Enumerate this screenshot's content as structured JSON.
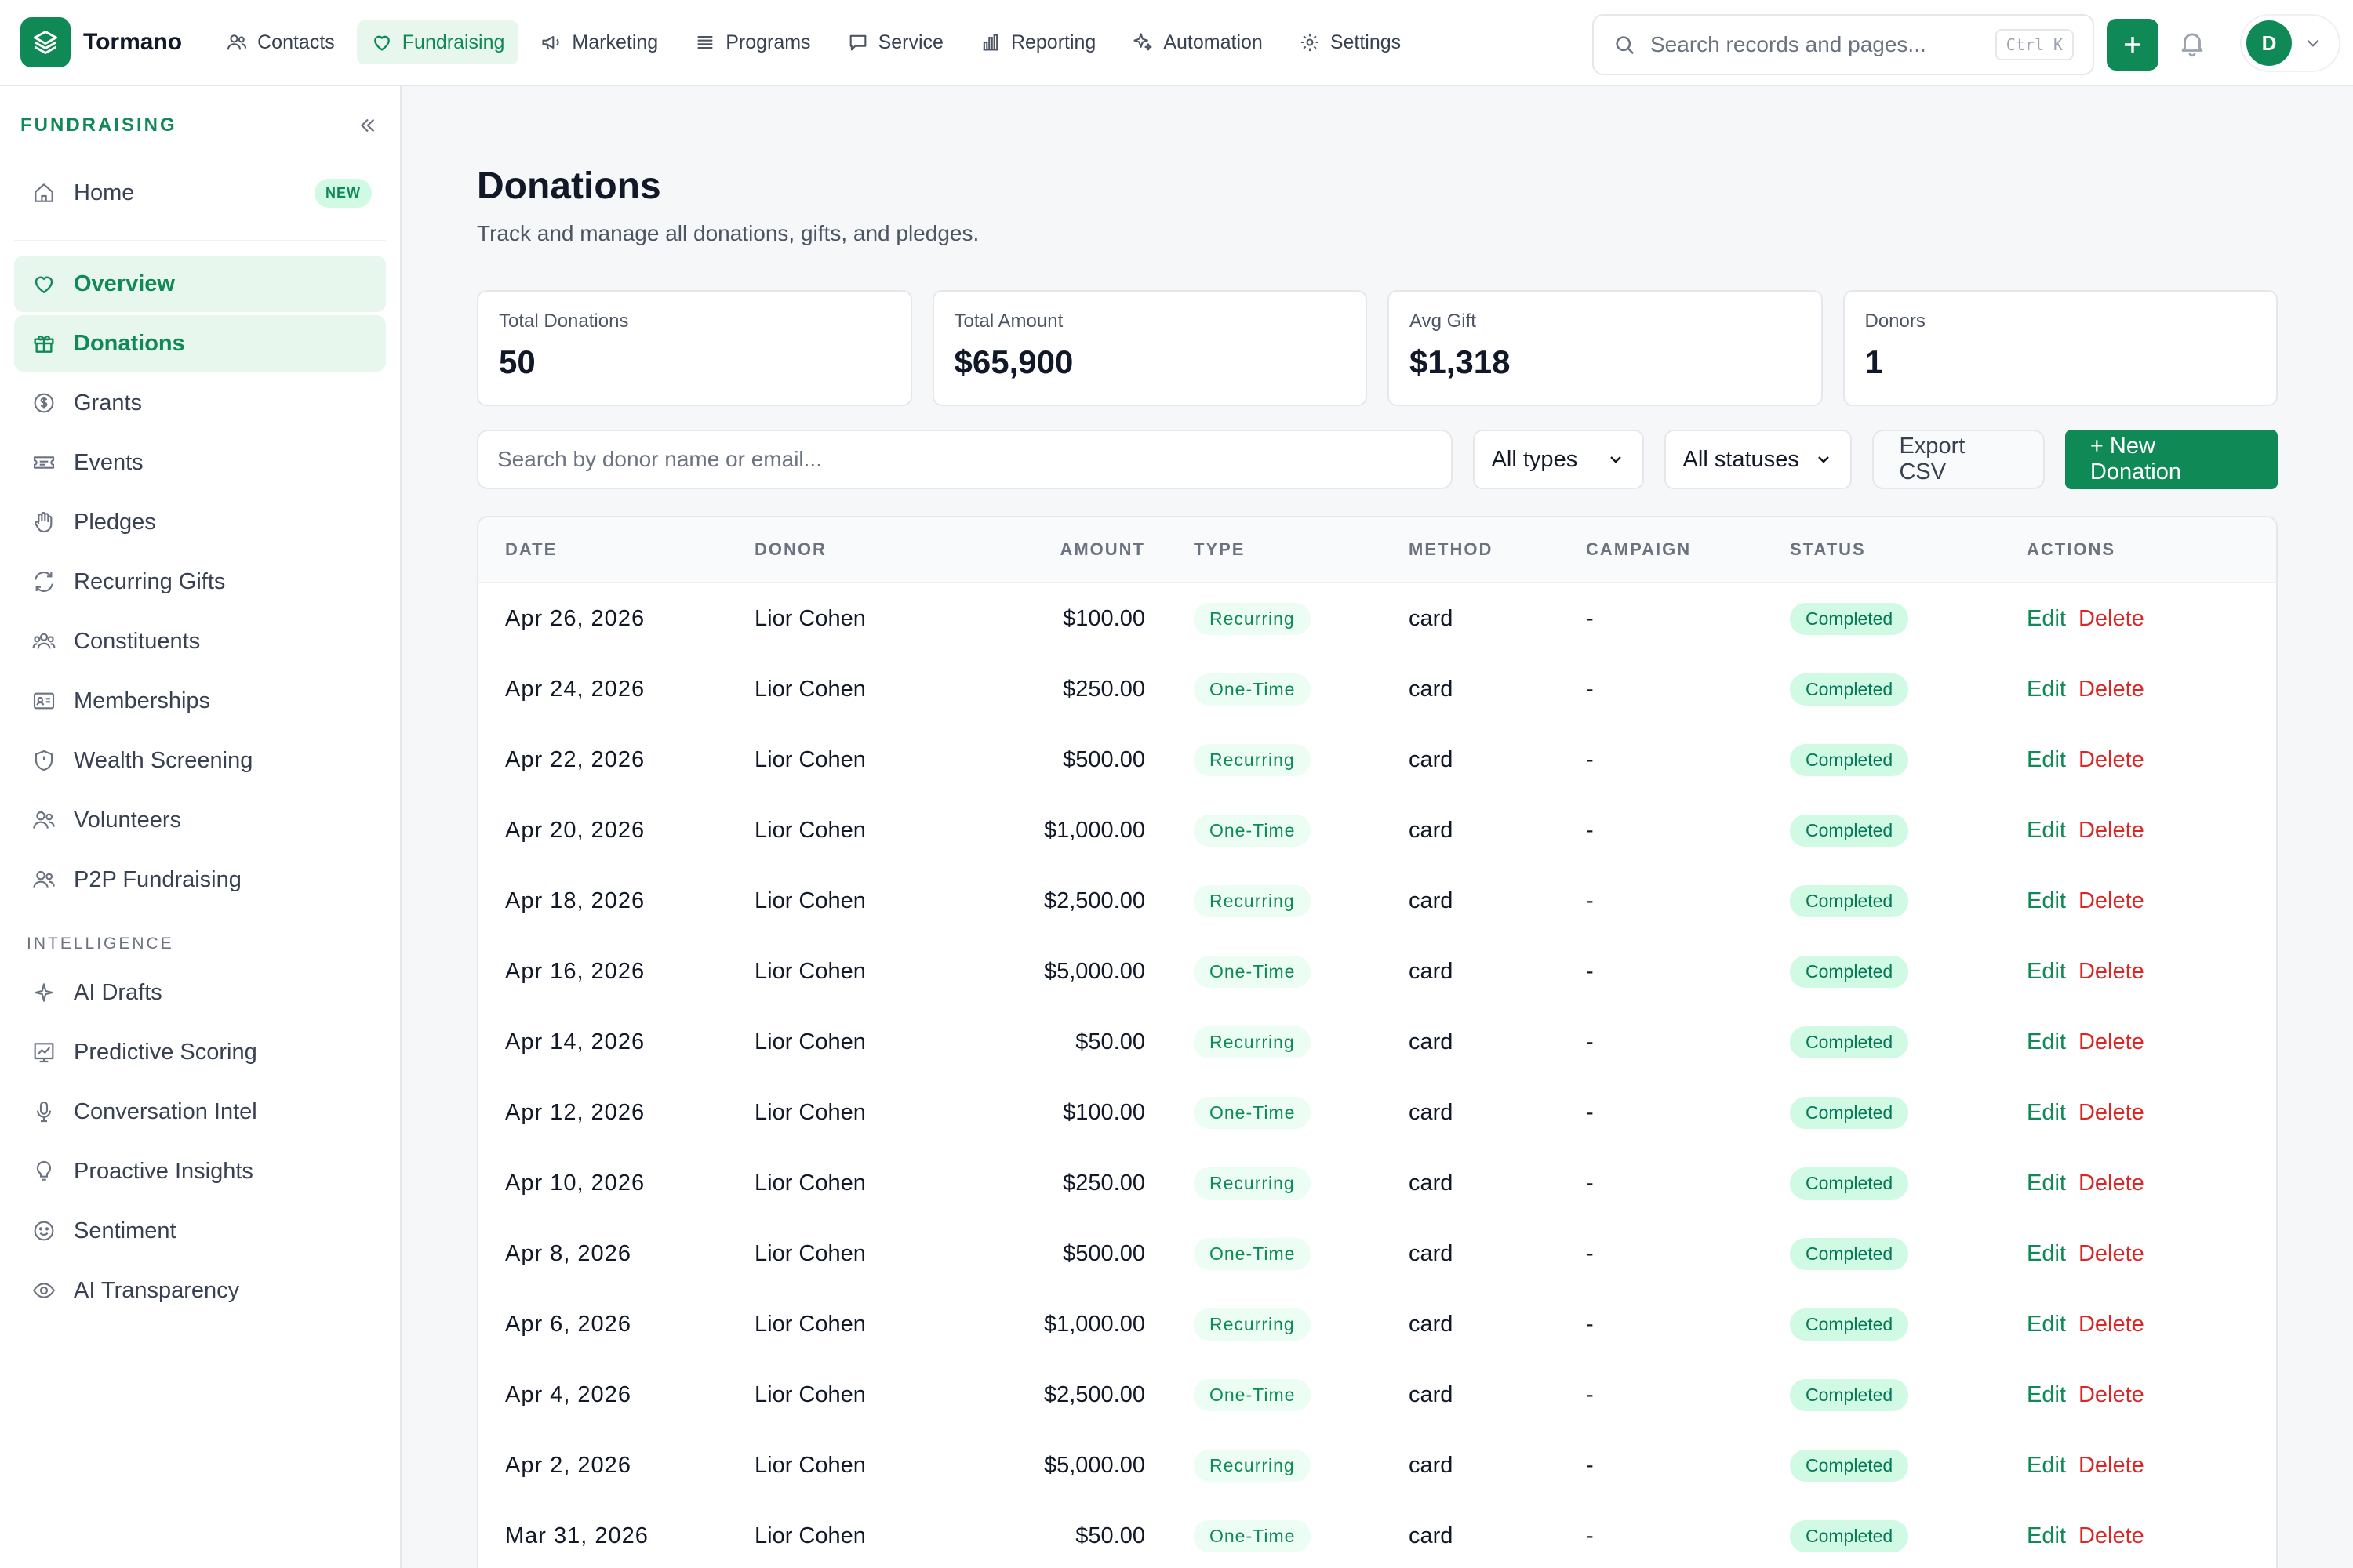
{
  "app": {
    "name": "Tormano"
  },
  "colors": {
    "brand": "#0f8a57",
    "brand_light": "#e8f7ee",
    "danger": "#dc2626"
  },
  "topnav": {
    "items": [
      {
        "label": "Contacts",
        "icon": "users-icon"
      },
      {
        "label": "Fundraising",
        "icon": "heart-icon"
      },
      {
        "label": "Marketing",
        "icon": "megaphone-icon"
      },
      {
        "label": "Programs",
        "icon": "list-icon"
      },
      {
        "label": "Service",
        "icon": "chat-icon"
      },
      {
        "label": "Reporting",
        "icon": "bar-chart-icon"
      },
      {
        "label": "Automation",
        "icon": "sparkle-icon"
      },
      {
        "label": "Settings",
        "icon": "gear-icon"
      }
    ],
    "active": "Fundraising",
    "search_placeholder": "Search records and pages...",
    "search_shortcut": "Ctrl K",
    "avatar_initial": "D"
  },
  "sidebar": {
    "title": "FUNDRAISING",
    "home": {
      "label": "Home",
      "badge": "NEW"
    },
    "items": [
      {
        "label": "Overview",
        "icon": "heart-icon"
      },
      {
        "label": "Donations",
        "icon": "gift-icon"
      },
      {
        "label": "Grants",
        "icon": "dollar-circle-icon"
      },
      {
        "label": "Events",
        "icon": "ticket-icon"
      },
      {
        "label": "Pledges",
        "icon": "hand-icon"
      },
      {
        "label": "Recurring Gifts",
        "icon": "refresh-icon"
      },
      {
        "label": "Constituents",
        "icon": "group-icon"
      },
      {
        "label": "Memberships",
        "icon": "id-card-icon"
      },
      {
        "label": "Wealth Screening",
        "icon": "shield-icon"
      },
      {
        "label": "Volunteers",
        "icon": "users-icon"
      },
      {
        "label": "P2P Fundraising",
        "icon": "users-icon"
      }
    ],
    "intelligence_title": "INTELLIGENCE",
    "intelligence_items": [
      {
        "label": "AI Drafts",
        "icon": "sparkle-icon"
      },
      {
        "label": "Predictive Scoring",
        "icon": "trend-chart-icon"
      },
      {
        "label": "Conversation Intel",
        "icon": "microphone-icon"
      },
      {
        "label": "Proactive Insights",
        "icon": "lightbulb-icon"
      },
      {
        "label": "Sentiment",
        "icon": "smile-icon"
      },
      {
        "label": "AI Transparency",
        "icon": "eye-icon"
      }
    ]
  },
  "page": {
    "title": "Donations",
    "subtitle": "Track and manage all donations, gifts, and pledges."
  },
  "stats": [
    {
      "label": "Total Donations",
      "value": "50"
    },
    {
      "label": "Total Amount",
      "value": "$65,900"
    },
    {
      "label": "Avg Gift",
      "value": "$1,318"
    },
    {
      "label": "Donors",
      "value": "1"
    }
  ],
  "toolbar": {
    "search_placeholder": "Search by donor name or email...",
    "type_filter": "All types",
    "status_filter": "All statuses",
    "export_label": "Export CSV",
    "new_label": "+ New Donation"
  },
  "table": {
    "columns": [
      "DATE",
      "DONOR",
      "AMOUNT",
      "TYPE",
      "METHOD",
      "CAMPAIGN",
      "STATUS",
      "ACTIONS"
    ],
    "edit_label": "Edit",
    "delete_label": "Delete",
    "rows": [
      {
        "date": "Apr 26, 2026",
        "donor": "Lior Cohen",
        "amount": "$100.00",
        "type": "Recurring",
        "method": "card",
        "campaign": "-",
        "status": "Completed"
      },
      {
        "date": "Apr 24, 2026",
        "donor": "Lior Cohen",
        "amount": "$250.00",
        "type": "One-Time",
        "method": "card",
        "campaign": "-",
        "status": "Completed"
      },
      {
        "date": "Apr 22, 2026",
        "donor": "Lior Cohen",
        "amount": "$500.00",
        "type": "Recurring",
        "method": "card",
        "campaign": "-",
        "status": "Completed"
      },
      {
        "date": "Apr 20, 2026",
        "donor": "Lior Cohen",
        "amount": "$1,000.00",
        "type": "One-Time",
        "method": "card",
        "campaign": "-",
        "status": "Completed"
      },
      {
        "date": "Apr 18, 2026",
        "donor": "Lior Cohen",
        "amount": "$2,500.00",
        "type": "Recurring",
        "method": "card",
        "campaign": "-",
        "status": "Completed"
      },
      {
        "date": "Apr 16, 2026",
        "donor": "Lior Cohen",
        "amount": "$5,000.00",
        "type": "One-Time",
        "method": "card",
        "campaign": "-",
        "status": "Completed"
      },
      {
        "date": "Apr 14, 2026",
        "donor": "Lior Cohen",
        "amount": "$50.00",
        "type": "Recurring",
        "method": "card",
        "campaign": "-",
        "status": "Completed"
      },
      {
        "date": "Apr 12, 2026",
        "donor": "Lior Cohen",
        "amount": "$100.00",
        "type": "One-Time",
        "method": "card",
        "campaign": "-",
        "status": "Completed"
      },
      {
        "date": "Apr 10, 2026",
        "donor": "Lior Cohen",
        "amount": "$250.00",
        "type": "Recurring",
        "method": "card",
        "campaign": "-",
        "status": "Completed"
      },
      {
        "date": "Apr 8, 2026",
        "donor": "Lior Cohen",
        "amount": "$500.00",
        "type": "One-Time",
        "method": "card",
        "campaign": "-",
        "status": "Completed"
      },
      {
        "date": "Apr 6, 2026",
        "donor": "Lior Cohen",
        "amount": "$1,000.00",
        "type": "Recurring",
        "method": "card",
        "campaign": "-",
        "status": "Completed"
      },
      {
        "date": "Apr 4, 2026",
        "donor": "Lior Cohen",
        "amount": "$2,500.00",
        "type": "One-Time",
        "method": "card",
        "campaign": "-",
        "status": "Completed"
      },
      {
        "date": "Apr 2, 2026",
        "donor": "Lior Cohen",
        "amount": "$5,000.00",
        "type": "Recurring",
        "method": "card",
        "campaign": "-",
        "status": "Completed"
      },
      {
        "date": "Mar 31, 2026",
        "donor": "Lior Cohen",
        "amount": "$50.00",
        "type": "One-Time",
        "method": "card",
        "campaign": "-",
        "status": "Completed"
      }
    ]
  }
}
